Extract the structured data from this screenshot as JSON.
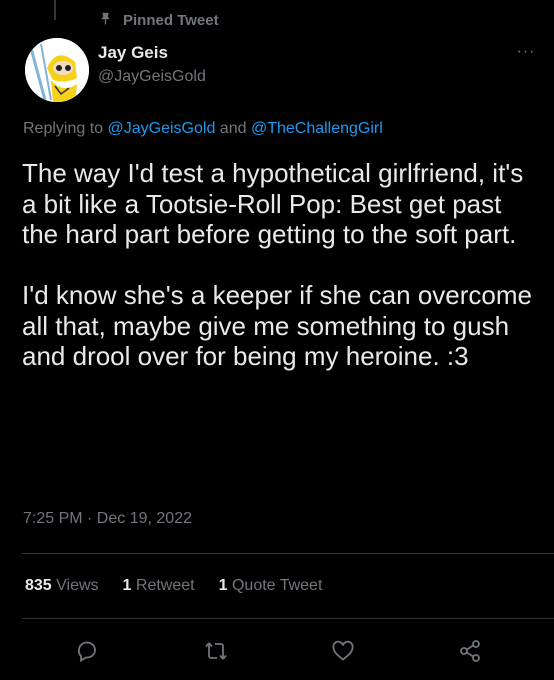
{
  "pinned": {
    "label": "Pinned Tweet",
    "icon": "pin-icon"
  },
  "author": {
    "name": "Jay Geis",
    "handle": "@JayGeisGold"
  },
  "more": {
    "label": "···"
  },
  "replying": {
    "prefix": "Replying to",
    "mention1": "@JayGeisGold",
    "conjunction": "and",
    "mention2": "@TheChallengGirl"
  },
  "tweet": {
    "text": "The way I'd test a hypothetical girlfriend, it's a bit like a Tootsie-Roll Pop: Best get past the hard part before getting to the soft part.\n\nI'd know she's a keeper if she can overcome all that, maybe give me something to gush and drool over for being my heroine. :3",
    "time": "7:25 PM · Dec 19, 2022"
  },
  "stats": {
    "views_count": "835",
    "views_label": "Views",
    "retweets_count": "1",
    "retweets_label": "Retweet",
    "quotes_count": "1",
    "quotes_label": "Quote Tweet"
  },
  "colors": {
    "background": "#000000",
    "text": "#e7e9ea",
    "muted": "#71767b",
    "link": "#1d9bf0"
  }
}
